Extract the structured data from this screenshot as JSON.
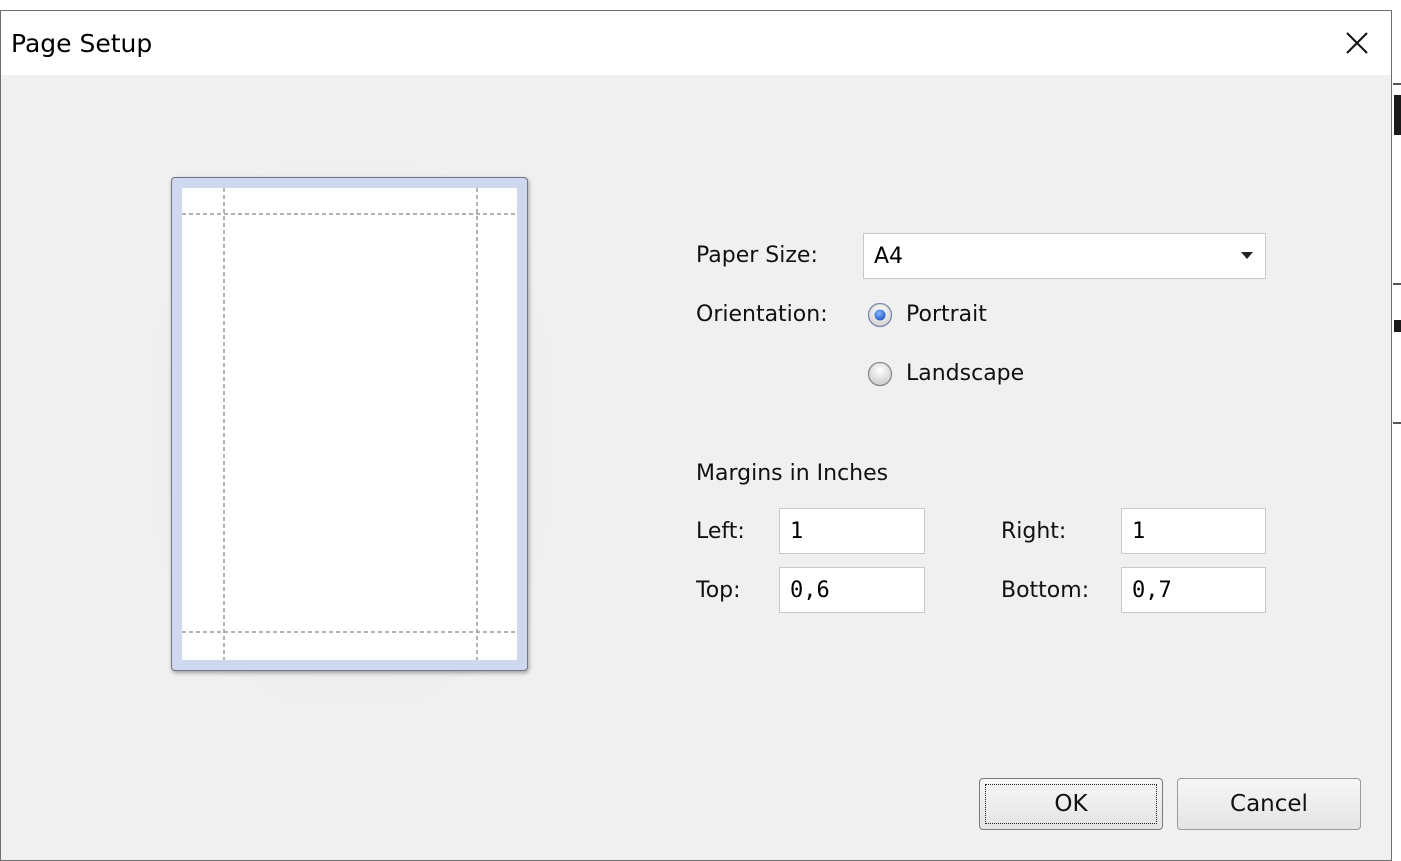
{
  "window": {
    "title": "Page Setup",
    "close_symbol": "✕"
  },
  "paper_size": {
    "label": "Paper Size:",
    "selected": "A4"
  },
  "orientation": {
    "label": "Orientation:",
    "options": [
      {
        "label": "Portrait",
        "selected": true
      },
      {
        "label": "Landscape",
        "selected": false
      }
    ]
  },
  "margins": {
    "heading": "Margins in Inches",
    "left_label": "Left:",
    "left_value": "1",
    "right_label": "Right:",
    "right_value": "1",
    "top_label": "Top:",
    "top_value": "0,6",
    "bottom_label": "Bottom:",
    "bottom_value": "0,7"
  },
  "buttons": {
    "ok": "OK",
    "cancel": "Cancel"
  },
  "colors": {
    "dialog_bg": "#f0f0f0",
    "preview_frame": "#cfd8ee",
    "radio_selected": "#3d7be0"
  },
  "icons": {
    "close": "close-icon",
    "dropdown": "chevron-down-icon"
  }
}
